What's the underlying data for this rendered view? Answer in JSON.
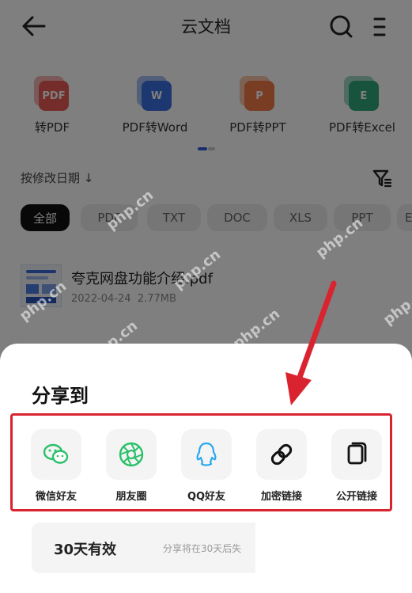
{
  "header": {
    "title": "云文档"
  },
  "tools": [
    {
      "label": "转PDF",
      "icon_text": "PDF",
      "color": "#e85a55"
    },
    {
      "label": "PDF转Word",
      "icon_text": "W",
      "color": "#3a6ee0"
    },
    {
      "label": "PDF转PPT",
      "icon_text": "P",
      "color": "#f07a45"
    },
    {
      "label": "PDF转Excel",
      "icon_text": "E",
      "color": "#2fa77a"
    }
  ],
  "sort": {
    "label": "按修改日期 ↓"
  },
  "chips": [
    "全部",
    "PDF",
    "TXT",
    "DOC",
    "XLS",
    "PPT",
    "EPUB"
  ],
  "file": {
    "name": "夸克网盘功能介绍.pdf",
    "date": "2022-04-24",
    "size": "2.77MB"
  },
  "share": {
    "title": "分享到",
    "items": [
      {
        "label": "微信好友",
        "icon": "wechat-icon",
        "color": "#2bc16b"
      },
      {
        "label": "朋友圈",
        "icon": "moments-icon",
        "color": "#2bc16b"
      },
      {
        "label": "QQ好友",
        "icon": "qq-icon",
        "color": "#29a8ef"
      },
      {
        "label": "加密链接",
        "icon": "link-icon",
        "color": "#111111"
      },
      {
        "label": "公开链接",
        "icon": "copy-link-icon",
        "color": "#111111"
      }
    ],
    "validity": {
      "title": "30天有效",
      "desc": "分享将在30天后失"
    }
  },
  "watermark": "php.cn",
  "accent_red": "#d92430"
}
